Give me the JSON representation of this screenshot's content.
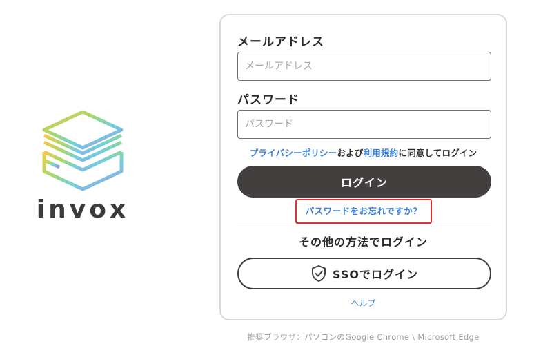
{
  "brand": {
    "logo_icon": "stacked-layers-logo",
    "name": "invox"
  },
  "login_form": {
    "email_label": "メールアドレス",
    "email_placeholder": "メールアドレス",
    "email_value": "",
    "password_label": "パスワード",
    "password_placeholder": "パスワード",
    "password_value": "",
    "agreement": {
      "privacy_link": "プライバシーポリシー",
      "and_text": "および",
      "terms_link": "利用規約",
      "suffix": "に同意してログイン"
    },
    "login_button": "ログイン",
    "forgot_password": "パスワードをお忘れですか？",
    "other_methods_heading": "その他の方法でログイン",
    "sso_button": "SSOでログイン",
    "sso_icon": "shield-check-icon",
    "help_link": "ヘルプ"
  },
  "footer": {
    "recommended_browsers": "推奨ブラウザ：パソコンのGoogle Chrome \\ Microsoft Edge"
  },
  "colors": {
    "primary_button": "#433f3f",
    "link": "#3b82e0",
    "highlight_border": "#e03030",
    "card_border": "#d9d9d9"
  }
}
